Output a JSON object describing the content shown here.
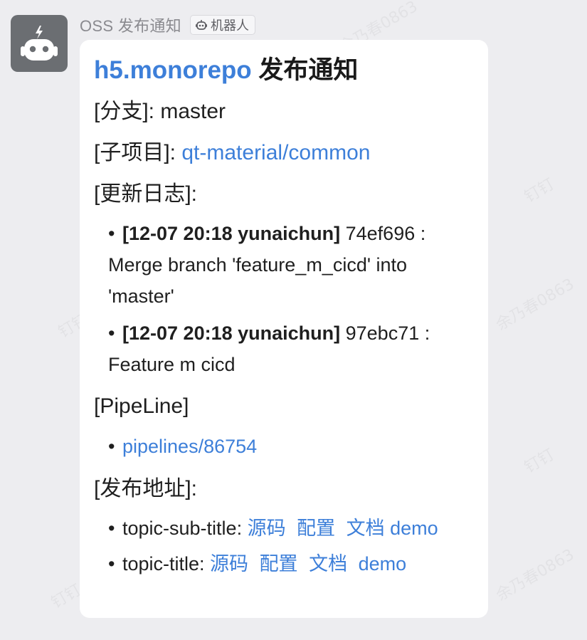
{
  "header": {
    "sender_name": "OSS 发布通知",
    "badge_label": "机器人"
  },
  "message": {
    "title_link": "h5.monorepo",
    "title_rest": " 发布通知",
    "branch": {
      "label": "[分支]:",
      "value": "master"
    },
    "subproject": {
      "label": "[子项目]:",
      "value": "qt-material/common"
    },
    "changelog": {
      "label": "[更新日志]:",
      "entries": [
        {
          "head": "[12-07 20:18 yunaichun]",
          "text": " 74ef696 : Merge branch 'feature_m_cicd' into 'master'"
        },
        {
          "head": "[12-07 20:18 yunaichun]",
          "text": " 97ebc71 : Feature m cicd"
        }
      ]
    },
    "pipeline": {
      "label": "[PipeLine]",
      "link": "pipelines/86754"
    },
    "deploy": {
      "label": "[发布地址]:",
      "items": [
        {
          "name": "topic-sub-title: ",
          "links": [
            "源码",
            "配置",
            "文档",
            "demo"
          ]
        },
        {
          "name": "topic-title: ",
          "links": [
            "源码",
            "配置",
            "文档",
            "demo"
          ]
        }
      ]
    }
  },
  "watermark_text": "余乃春0863",
  "watermark_app": "钉钉",
  "colors": {
    "link": "#3d7fd9",
    "bubble": "#ffffff",
    "background": "#ededf0",
    "avatar": "#6b6e72"
  },
  "icons": {
    "avatar": "robot-icon",
    "badge": "robot-small-icon"
  }
}
